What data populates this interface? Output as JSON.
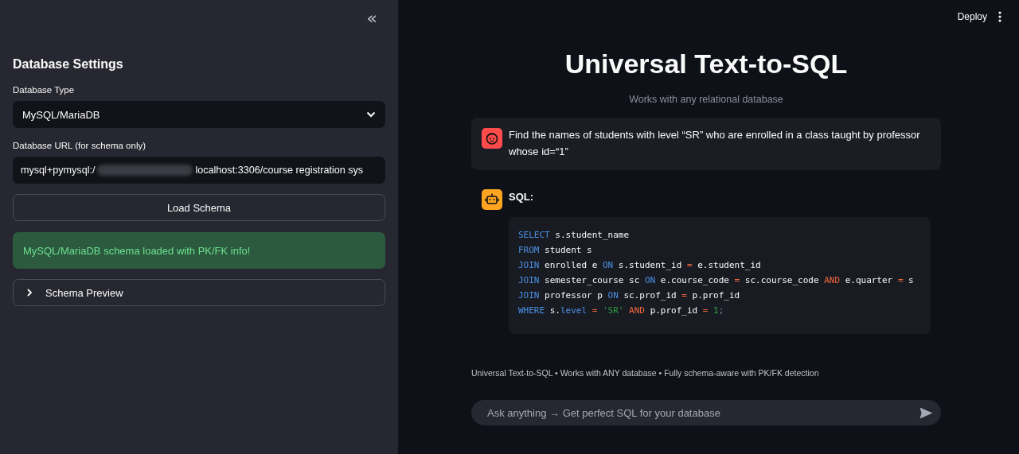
{
  "sidebar": {
    "collapse_icon": "«",
    "heading": "Database Settings",
    "db_type": {
      "label": "Database Type",
      "value": "MySQL/MariaDB"
    },
    "db_url": {
      "label": "Database URL (for schema only)",
      "value_start": "mysql+pymysql:/",
      "redacted": true,
      "value_end": "localhost:3306/course registration sys"
    },
    "load_button": "Load Schema",
    "success_message": "MySQL/MariaDB schema loaded with PK/FK info!",
    "expander": {
      "label": "Schema Preview",
      "expanded": false
    }
  },
  "header": {
    "deploy": "Deploy"
  },
  "main": {
    "title": "Universal Text-to-SQL",
    "subtitle": "Works with any relational database",
    "messages": [
      {
        "kind": "user",
        "text": "Find the names of students with level “SR” who are enrolled in a class taught by professor whose id=“1”"
      },
      {
        "kind": "assistant",
        "label": "SQL:",
        "code": [
          [
            {
              "kind": "keyword",
              "text": "SELECT"
            },
            {
              "kind": "ident",
              "text": " s.student_name"
            }
          ],
          [
            {
              "kind": "keyword",
              "text": "FROM"
            },
            {
              "kind": "ident",
              "text": " student s"
            }
          ],
          [
            {
              "kind": "keyword",
              "text": "JOIN"
            },
            {
              "kind": "ident",
              "text": " enrolled e "
            },
            {
              "kind": "keyword",
              "text": "ON"
            },
            {
              "kind": "ident",
              "text": " s.student_id "
            },
            {
              "kind": "operator",
              "text": "="
            },
            {
              "kind": "ident",
              "text": " e.student_id"
            }
          ],
          [
            {
              "kind": "keyword",
              "text": "JOIN"
            },
            {
              "kind": "ident",
              "text": " semester_course sc "
            },
            {
              "kind": "keyword",
              "text": "ON"
            },
            {
              "kind": "ident",
              "text": " e.course_code "
            },
            {
              "kind": "operator",
              "text": "="
            },
            {
              "kind": "ident",
              "text": " sc.course_code "
            },
            {
              "kind": "operator",
              "text": "AND"
            },
            {
              "kind": "ident",
              "text": " e.quarter "
            },
            {
              "kind": "operator",
              "text": "="
            },
            {
              "kind": "ident",
              "text": " s"
            }
          ],
          [
            {
              "kind": "keyword",
              "text": "JOIN"
            },
            {
              "kind": "ident",
              "text": " professor p "
            },
            {
              "kind": "keyword",
              "text": "ON"
            },
            {
              "kind": "ident",
              "text": " sc.prof_id "
            },
            {
              "kind": "operator",
              "text": "="
            },
            {
              "kind": "ident",
              "text": " p.prof_id"
            }
          ],
          [
            {
              "kind": "keyword",
              "text": "WHERE"
            },
            {
              "kind": "ident",
              "text": " s."
            },
            {
              "kind": "keyword",
              "text": "level"
            },
            {
              "kind": "operator",
              "text": " = "
            },
            {
              "kind": "string",
              "text": "'SR'"
            },
            {
              "kind": "operator",
              "text": " AND "
            },
            {
              "kind": "ident",
              "text": "p.prof_id "
            },
            {
              "kind": "operator",
              "text": "="
            },
            {
              "kind": "number",
              "text": " 1"
            },
            {
              "kind": "punct",
              "text": ";"
            }
          ]
        ]
      }
    ],
    "footer": "Universal Text-to-SQL • Works with ANY database • Fully schema-aware with PK/FK detection",
    "chat_input": {
      "placeholder": "Ask anything → Get perfect SQL for your database"
    }
  }
}
